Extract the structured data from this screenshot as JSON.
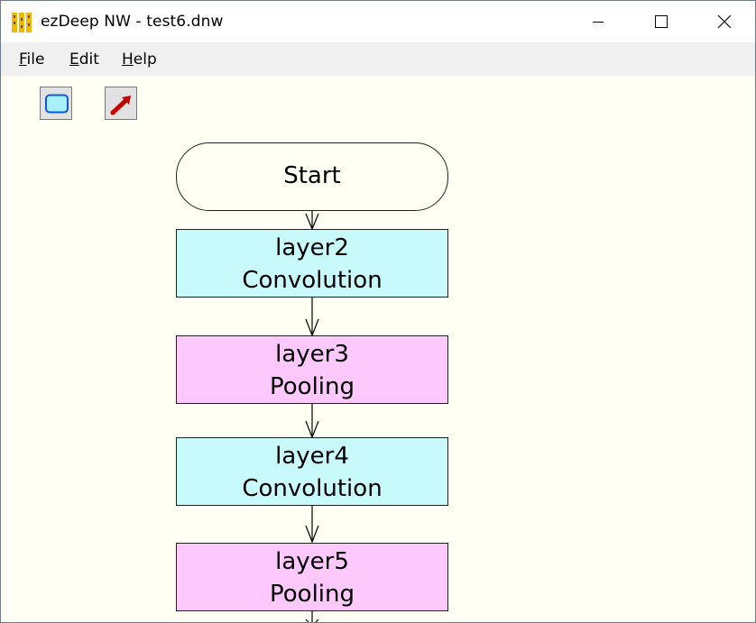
{
  "window": {
    "title": "ezDeep NW - test6.dnw",
    "controls": [
      "minimize",
      "maximize",
      "close"
    ]
  },
  "menu": [
    {
      "label": "File",
      "mnemonic": "F",
      "rest": "ile"
    },
    {
      "label": "Edit",
      "mnemonic": "E",
      "rest": "dit"
    },
    {
      "label": "Help",
      "mnemonic": "H",
      "rest": "elp"
    }
  ],
  "toolbar": {
    "tools": [
      {
        "name": "rectangle-tool",
        "icon": "rounded-rectangle-icon"
      },
      {
        "name": "arrow-tool",
        "icon": "red-arrow-icon"
      }
    ]
  },
  "flowchart": {
    "start": {
      "label": "Start"
    },
    "nodes": [
      {
        "name": "layer2",
        "type": "Convolution",
        "color": "#c8fafc"
      },
      {
        "name": "layer3",
        "type": "Pooling",
        "color": "#fdc9fd"
      },
      {
        "name": "layer4",
        "type": "Convolution",
        "color": "#c8fafc"
      },
      {
        "name": "layer5",
        "type": "Pooling",
        "color": "#fdc9fd"
      }
    ]
  },
  "colors": {
    "canvas_bg": "#fffff4",
    "convolution": "#c8fafc",
    "pooling": "#fdc9fd",
    "menubar_bg": "#f0f0f0"
  }
}
